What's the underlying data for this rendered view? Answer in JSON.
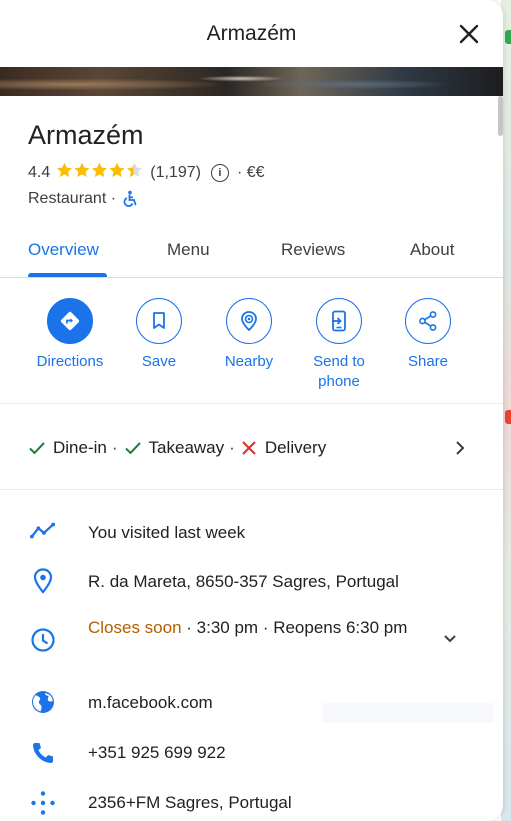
{
  "header": {
    "title": "Armazém"
  },
  "place": {
    "name": "Armazém",
    "rating": "4.4",
    "stars_value": 4.4,
    "review_count": "(1,197)",
    "price": "· €€",
    "category": "Restaurant ·"
  },
  "tabs": [
    {
      "label": "Overview",
      "active": true
    },
    {
      "label": "Menu",
      "active": false
    },
    {
      "label": "Reviews",
      "active": false
    },
    {
      "label": "About",
      "active": false
    }
  ],
  "actions": [
    {
      "label": "Directions",
      "icon": "directions-icon"
    },
    {
      "label": "Save",
      "icon": "bookmark-icon"
    },
    {
      "label": "Nearby",
      "icon": "nearby-icon"
    },
    {
      "label": "Send to phone",
      "icon": "send-to-phone-icon"
    },
    {
      "label": "Share",
      "icon": "share-icon"
    }
  ],
  "services": [
    {
      "label": "Dine-in",
      "available": true,
      "sep": "·"
    },
    {
      "label": "Takeaway",
      "available": true,
      "sep": "·"
    },
    {
      "label": "Delivery",
      "available": false,
      "sep": ""
    }
  ],
  "info": {
    "visited": "You visited last week",
    "address": "R. da Mareta, 8650-357 Sagres, Portugal",
    "hours_status": "Closes soon",
    "hours_rest": " · 3:30 pm · Reopens 6:30 pm",
    "website": "m.facebook.com",
    "phone": "+351 925 699 922",
    "plus_code": "2356+FM Sagres, Portugal"
  },
  "colors": {
    "accent": "#1a73e8",
    "star": "#fbbc04",
    "check": "#188038",
    "cross": "#d93025",
    "warning": "#b06000"
  }
}
